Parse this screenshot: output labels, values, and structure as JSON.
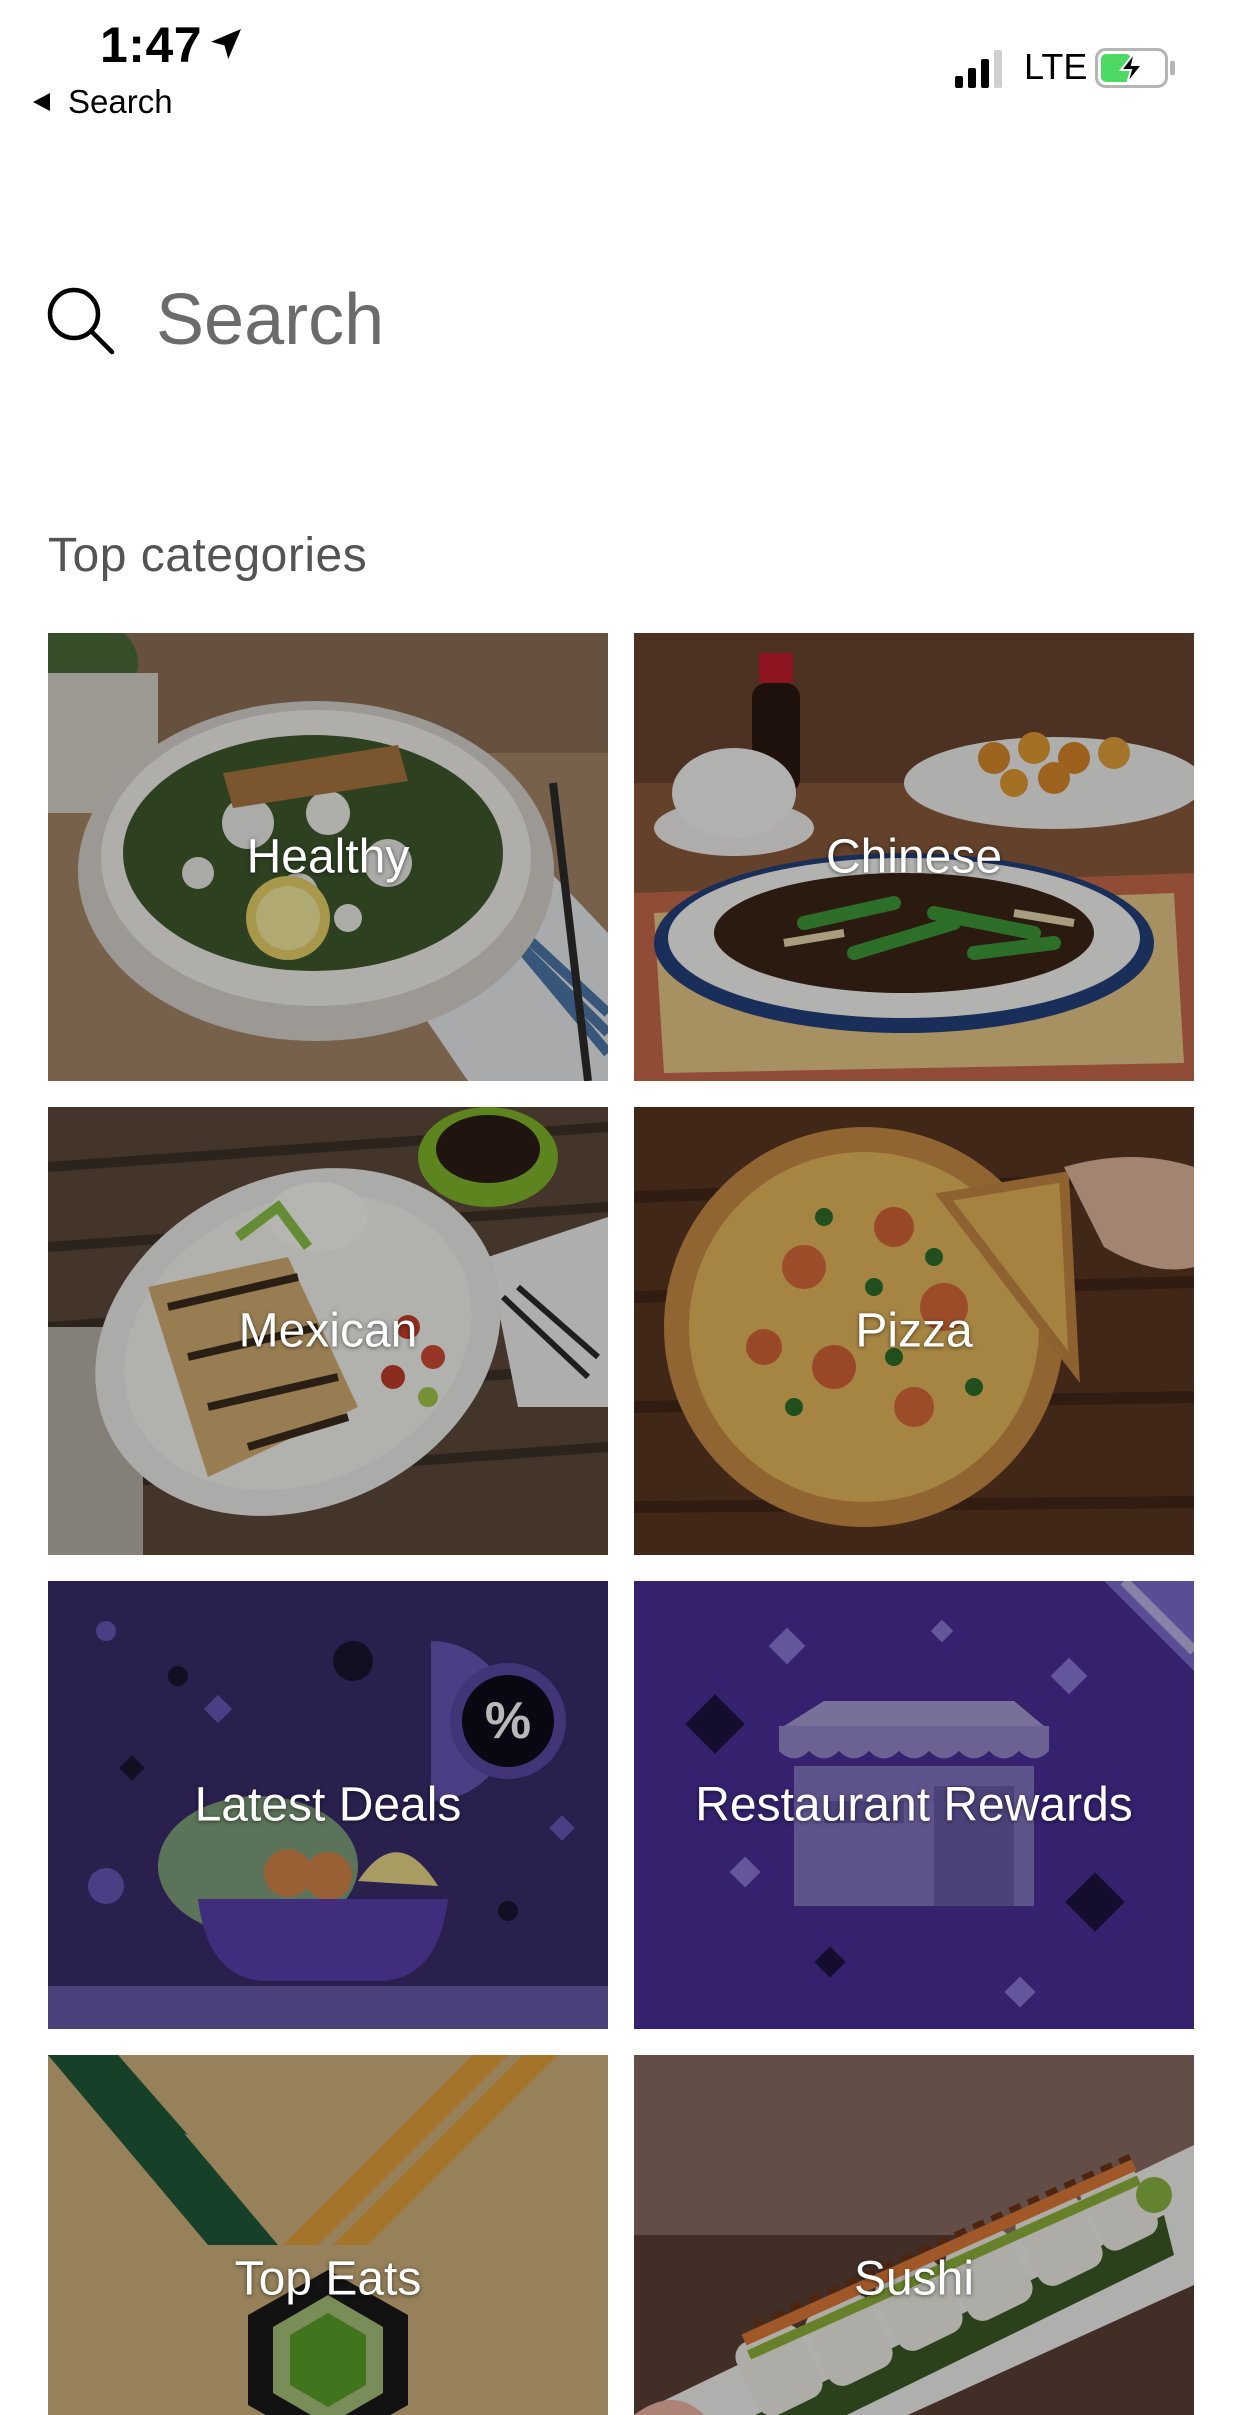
{
  "status_bar": {
    "time": "1:47",
    "back_label": "Search",
    "network": "LTE",
    "icons": [
      "location-arrow-icon",
      "back-arrow-icon",
      "signal-bars-icon",
      "battery-charging-icon"
    ]
  },
  "search": {
    "placeholder": "Search",
    "value": ""
  },
  "section": {
    "title": "Top categories"
  },
  "categories": [
    {
      "label": "Healthy"
    },
    {
      "label": "Chinese"
    },
    {
      "label": "Mexican"
    },
    {
      "label": "Pizza"
    },
    {
      "label": "Latest Deals"
    },
    {
      "label": "Restaurant Rewards"
    },
    {
      "label": "Top Eats"
    },
    {
      "label": "Sushi"
    }
  ],
  "colors": {
    "background": "#ffffff",
    "text": "#000000",
    "muted_text": "#545454",
    "tile_label": "#ffffff",
    "deals_purple": "#2e2458",
    "rewards_purple": "#3c2a6f",
    "top_eats_gold": "#a48c5c",
    "battery_green": "#4cd964"
  }
}
